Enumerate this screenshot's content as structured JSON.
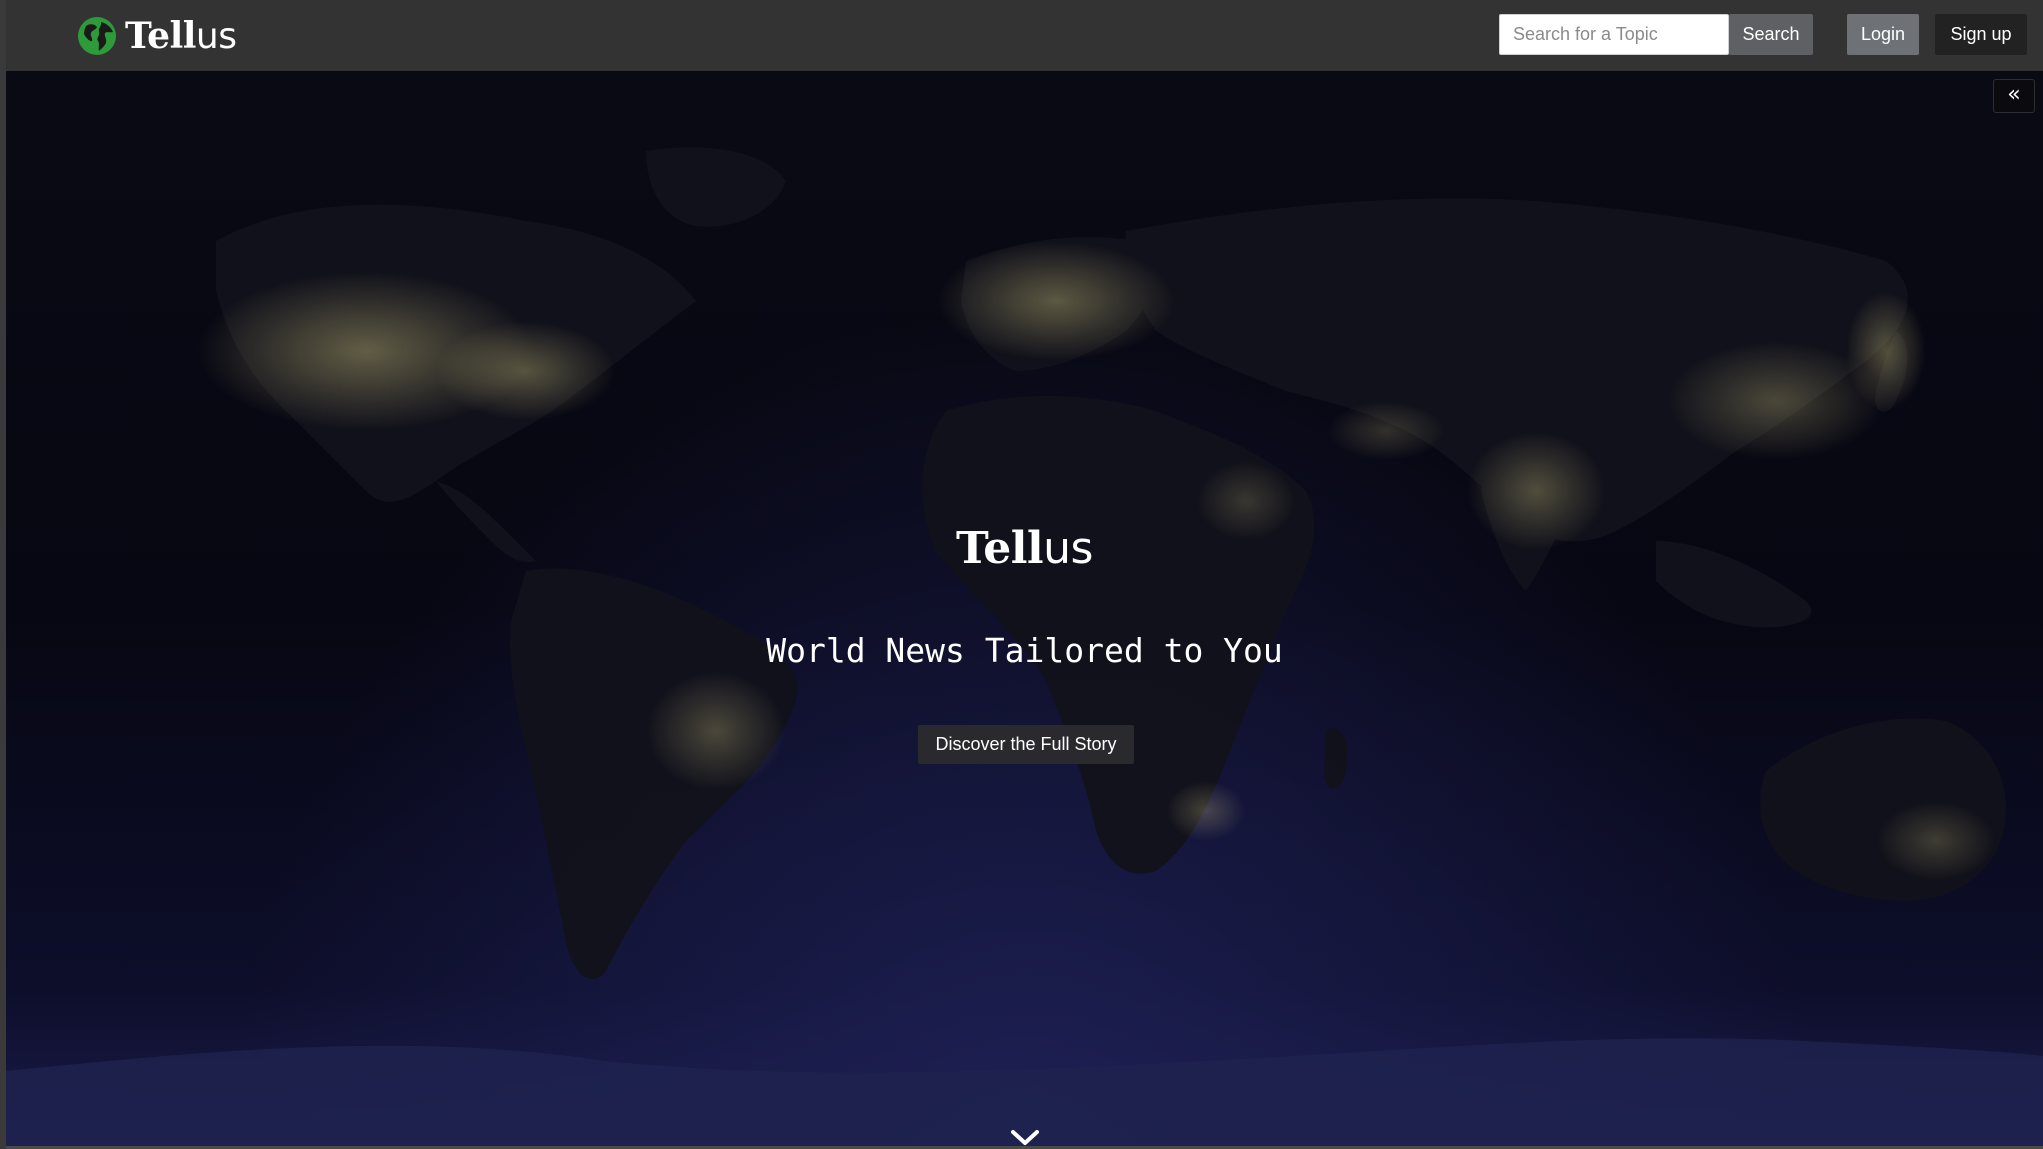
{
  "navbar": {
    "brand": {
      "tell": "Tell",
      "us": "us"
    },
    "search": {
      "placeholder": "Search for a Topic",
      "value": ""
    },
    "search_label": "Search",
    "login_label": "Login",
    "signup_label": "Sign up"
  },
  "hero": {
    "collapse_icon": "«",
    "logo": {
      "tell": "Tell",
      "us": "us"
    },
    "tagline": "World News Tailored to You",
    "cta_label": "Discover the Full Story",
    "scroll_icon": "chevron-down-icon"
  },
  "colors": {
    "brand_globe": "#2e9b3a",
    "navbar_bg": "#333333",
    "search_button_bg": "#5f6063",
    "login_button_bg": "#6e7277",
    "signup_button_bg": "#222222",
    "city_lights": "#e6d98a"
  }
}
